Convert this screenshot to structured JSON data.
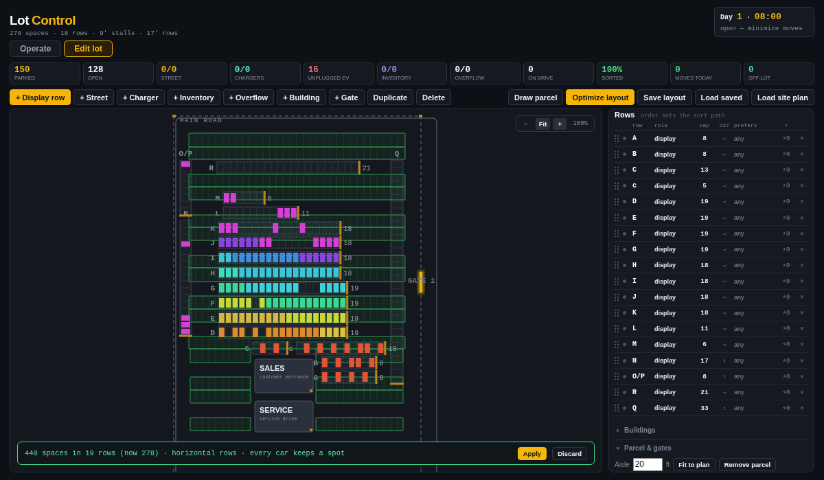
{
  "header": {
    "title_lead": "Lot",
    "title_accent": "Control",
    "subtitle": "278 spaces · 18 rows · 9' stalls · 17' rows",
    "modes": [
      {
        "label": "Operate",
        "selected": false
      },
      {
        "label": "Edit lot",
        "selected": true
      }
    ],
    "clock": {
      "day_label": "Day",
      "day": "1",
      "separator": "·",
      "time": "08:00",
      "status": "open — minimize moves"
    }
  },
  "stats": [
    {
      "value": "150",
      "label": "PARKED",
      "color": "#f5b50a"
    },
    {
      "value": "128",
      "label": "OPEN",
      "color": "#ffffff"
    },
    {
      "value": "0/0",
      "label": "STREET",
      "color": "#f5b50a"
    },
    {
      "value": "0/0",
      "label": "CHARGERS",
      "color": "#5eead4"
    },
    {
      "value": "16",
      "label": "UNPLUGGED EV",
      "color": "#f87171"
    },
    {
      "value": "0/0",
      "label": "INVENTORY",
      "color": "#a78bfa"
    },
    {
      "value": "0/0",
      "label": "OVERFLOW",
      "color": "#ffffff"
    },
    {
      "value": "0",
      "label": "ON DRIVE",
      "color": "#ffffff"
    },
    {
      "value": "100%",
      "label": "SORTED",
      "color": "#4ade80"
    },
    {
      "value": "0",
      "label": "MOVES TODAY",
      "color": "#4ade80"
    },
    {
      "value": "0",
      "label": "OFF-LOT",
      "color": "#4ade80"
    }
  ],
  "toolbar_left": [
    {
      "label": "+ Display row",
      "primary": true
    },
    {
      "label": "+ Street",
      "primary": false
    },
    {
      "label": "+ Charger",
      "primary": false
    },
    {
      "label": "+ Inventory",
      "primary": false
    },
    {
      "label": "+ Overflow",
      "primary": false
    },
    {
      "label": "+ Building",
      "primary": false
    },
    {
      "label": "+ Gate",
      "primary": false
    },
    {
      "label": "Duplicate",
      "primary": false
    },
    {
      "label": "Delete",
      "primary": false
    }
  ],
  "toolbar_right": [
    {
      "label": "Draw parcel",
      "primary": false
    },
    {
      "label": "Optimize layout",
      "primary": true
    },
    {
      "label": "Save layout",
      "primary": false
    },
    {
      "label": "Load saved",
      "primary": false
    },
    {
      "label": "Load site plan",
      "primary": false
    }
  ],
  "map": {
    "road_label": "MAIN ROAD",
    "gate_label": "GATE 1",
    "zoom": {
      "minus": "−",
      "fit": "Fit",
      "plus": "+",
      "percent": "100%"
    },
    "rows": [
      {
        "label": "O/P",
        "slots": [
          {
            "occupied": true,
            "color": "#d63fd6"
          },
          {
            "occupied": false
          },
          {
            "occupied": false
          },
          {
            "occupied": false
          },
          {
            "occupied": false
          },
          {
            "occupied": false
          },
          {
            "occupied": false
          },
          {
            "occupied": false
          }
        ]
      },
      {
        "label": "Q",
        "slots": [
          {
            "occupied": false
          },
          {
            "occupied": false
          },
          {
            "occupied": false
          },
          {
            "occupied": false
          },
          {
            "occupied": false
          },
          {
            "occupied": false
          },
          {
            "occupied": false
          },
          {
            "occupied": false
          },
          {
            "occupied": false
          },
          {
            "occupied": false
          },
          {
            "occupied": false
          },
          {
            "occupied": false
          },
          {
            "occupied": false
          },
          {
            "occupied": false
          },
          {
            "occupied": false
          },
          {
            "occupied": false
          },
          {
            "occupied": false
          },
          {
            "occupied": false
          },
          {
            "occupied": false
          },
          {
            "occupied": false
          },
          {
            "occupied": false
          },
          {
            "occupied": false
          },
          {
            "occupied": false
          },
          {
            "occupied": false
          },
          {
            "occupied": false
          },
          {
            "occupied": false
          },
          {
            "occupied": false
          },
          {
            "occupied": false
          },
          {
            "occupied": false
          },
          {
            "occupied": false
          },
          {
            "occupied": false
          },
          {
            "occupied": false
          },
          {
            "occupied": false
          }
        ]
      },
      {
        "label": "R",
        "count": "21",
        "slots": [
          {
            "occupied": false
          },
          {
            "occupied": false
          },
          {
            "occupied": false
          },
          {
            "occupied": false
          },
          {
            "occupied": false
          },
          {
            "occupied": false
          },
          {
            "occupied": false
          },
          {
            "occupied": false
          },
          {
            "occupied": false
          },
          {
            "occupied": false
          },
          {
            "occupied": false
          },
          {
            "occupied": false
          },
          {
            "occupied": false
          },
          {
            "occupied": false
          },
          {
            "occupied": false
          },
          {
            "occupied": false
          },
          {
            "occupied": false
          },
          {
            "occupied": false
          },
          {
            "occupied": false
          },
          {
            "occupied": false
          },
          {
            "occupied": false
          }
        ]
      },
      {
        "label": "M",
        "count": "6",
        "slots": [
          {
            "occupied": true,
            "color": "#d63fd6"
          },
          {
            "occupied": true,
            "color": "#d63fd6"
          },
          {
            "occupied": false
          },
          {
            "occupied": false
          },
          {
            "occupied": false
          },
          {
            "occupied": false
          }
        ]
      },
      {
        "label": "N",
        "slots": [
          {
            "occupied": false
          },
          {
            "occupied": false
          },
          {
            "occupied": false
          },
          {
            "occupied": true,
            "color": "#d63fd6"
          },
          {
            "occupied": false
          },
          {
            "occupied": false
          },
          {
            "occupied": false
          },
          {
            "occupied": false
          },
          {
            "occupied": false
          },
          {
            "occupied": false
          },
          {
            "occupied": false
          },
          {
            "occupied": false
          },
          {
            "occupied": false
          },
          {
            "occupied": false
          },
          {
            "occupied": true,
            "color": "#d63fd6"
          },
          {
            "occupied": true,
            "color": "#d63fd6"
          },
          {
            "occupied": true,
            "color": "#d63fd6"
          }
        ]
      },
      {
        "label": "L",
        "count": "11",
        "slots": [
          {
            "occupied": false
          },
          {
            "occupied": false
          },
          {
            "occupied": false
          },
          {
            "occupied": false
          },
          {
            "occupied": false
          },
          {
            "occupied": false
          },
          {
            "occupied": false
          },
          {
            "occupied": false
          },
          {
            "occupied": true,
            "color": "#d63fd6"
          },
          {
            "occupied": true,
            "color": "#d63fd6"
          },
          {
            "occupied": true,
            "color": "#d63fd6"
          }
        ]
      },
      {
        "label": "K",
        "count": "18",
        "slots": [
          {
            "occupied": true,
            "color": "#d63fd6"
          },
          {
            "occupied": true,
            "color": "#d63fd6"
          },
          {
            "occupied": true,
            "color": "#d63fd6"
          },
          {
            "occupied": false
          },
          {
            "occupied": false
          },
          {
            "occupied": false
          },
          {
            "occupied": false
          },
          {
            "occupied": false
          },
          {
            "occupied": true,
            "color": "#d63fd6"
          },
          {
            "occupied": false
          },
          {
            "occupied": false
          },
          {
            "occupied": false
          },
          {
            "occupied": true,
            "color": "#d63fd6"
          },
          {
            "occupied": false
          },
          {
            "occupied": false
          },
          {
            "occupied": false
          },
          {
            "occupied": false
          },
          {
            "occupied": false
          }
        ]
      },
      {
        "label": "J",
        "count": "18",
        "slots": [
          {
            "occupied": true,
            "color": "#8a45e0"
          },
          {
            "occupied": true,
            "color": "#8a45e0"
          },
          {
            "occupied": true,
            "color": "#8a45e0"
          },
          {
            "occupied": true,
            "color": "#8a45e0"
          },
          {
            "occupied": true,
            "color": "#8a45e0"
          },
          {
            "occupied": true,
            "color": "#8a45e0"
          },
          {
            "occupied": true,
            "color": "#d63fd6"
          },
          {
            "occupied": true,
            "color": "#d63fd6"
          },
          {
            "occupied": false
          },
          {
            "occupied": false
          },
          {
            "occupied": false
          },
          {
            "occupied": false
          },
          {
            "occupied": false
          },
          {
            "occupied": false
          },
          {
            "occupied": true,
            "color": "#d63fd6"
          },
          {
            "occupied": true,
            "color": "#d63fd6"
          },
          {
            "occupied": true,
            "color": "#d63fd6"
          },
          {
            "occupied": true,
            "color": "#d63fd6"
          }
        ]
      },
      {
        "label": "I",
        "count": "18",
        "slots": [
          {
            "occupied": true,
            "color": "#3cc4d8"
          },
          {
            "occupied": true,
            "color": "#3cc4d8"
          },
          {
            "occupied": true,
            "color": "#3d8ee0"
          },
          {
            "occupied": true,
            "color": "#3d8ee0"
          },
          {
            "occupied": true,
            "color": "#3d8ee0"
          },
          {
            "occupied": true,
            "color": "#3d8ee0"
          },
          {
            "occupied": true,
            "color": "#3d8ee0"
          },
          {
            "occupied": true,
            "color": "#3d8ee0"
          },
          {
            "occupied": true,
            "color": "#3d8ee0"
          },
          {
            "occupied": true,
            "color": "#3d8ee0"
          },
          {
            "occupied": true,
            "color": "#3d8ee0"
          },
          {
            "occupied": true,
            "color": "#3d8ee0"
          },
          {
            "occupied": true,
            "color": "#8a45e0"
          },
          {
            "occupied": true,
            "color": "#8a45e0"
          },
          {
            "occupied": true,
            "color": "#8a45e0"
          },
          {
            "occupied": true,
            "color": "#8a45e0"
          },
          {
            "occupied": true,
            "color": "#8a45e0"
          },
          {
            "occupied": true,
            "color": "#8a45e0"
          }
        ]
      },
      {
        "label": "H",
        "count": "18",
        "slots": [
          {
            "occupied": true,
            "color": "#3ddcc0"
          },
          {
            "occupied": true,
            "color": "#3ddcc0"
          },
          {
            "occupied": true,
            "color": "#3ddcc0"
          },
          {
            "occupied": true,
            "color": "#3cc4d8"
          },
          {
            "occupied": true,
            "color": "#3cc4d8"
          },
          {
            "occupied": true,
            "color": "#3cc4d8"
          },
          {
            "occupied": true,
            "color": "#3cc4d8"
          },
          {
            "occupied": true,
            "color": "#3cc4d8"
          },
          {
            "occupied": true,
            "color": "#3cc4d8"
          },
          {
            "occupied": true,
            "color": "#3cc4d8"
          },
          {
            "occupied": true,
            "color": "#3cc4d8"
          },
          {
            "occupied": true,
            "color": "#3cc4d8"
          },
          {
            "occupied": true,
            "color": "#3cc4d8"
          },
          {
            "occupied": true,
            "color": "#3cc4d8"
          },
          {
            "occupied": true,
            "color": "#3cc4d8"
          },
          {
            "occupied": true,
            "color": "#3cc4d8"
          },
          {
            "occupied": true,
            "color": "#3cc4d8"
          },
          {
            "occupied": true,
            "color": "#3cc4d8"
          }
        ]
      },
      {
        "label": "G",
        "count": "19",
        "slots": [
          {
            "occupied": true,
            "color": "#3dd6a0"
          },
          {
            "occupied": true,
            "color": "#3dd6a0"
          },
          {
            "occupied": true,
            "color": "#3dd6a0"
          },
          {
            "occupied": true,
            "color": "#3dd6a0"
          },
          {
            "occupied": true,
            "color": "#3cd0d8"
          },
          {
            "occupied": true,
            "color": "#3cd0d8"
          },
          {
            "occupied": true,
            "color": "#3cd0d8"
          },
          {
            "occupied": true,
            "color": "#3cd0d8"
          },
          {
            "occupied": true,
            "color": "#3cd0d8"
          },
          {
            "occupied": true,
            "color": "#3cd0d8"
          },
          {
            "occupied": true,
            "color": "#3cd0d8"
          },
          {
            "occupied": true,
            "color": "#3cd0d8"
          },
          {
            "occupied": false
          },
          {
            "occupied": false
          },
          {
            "occupied": false
          },
          {
            "occupied": true,
            "color": "#3cd0d8"
          },
          {
            "occupied": true,
            "color": "#3cd0d8"
          },
          {
            "occupied": true,
            "color": "#3cd0d8"
          },
          {
            "occupied": true,
            "color": "#3cd0d8"
          }
        ]
      },
      {
        "label": "F",
        "count": "19",
        "slots": [
          {
            "occupied": true,
            "color": "#c6d83a"
          },
          {
            "occupied": true,
            "color": "#c6d83a"
          },
          {
            "occupied": true,
            "color": "#c6d83a"
          },
          {
            "occupied": true,
            "color": "#c6d83a"
          },
          {
            "occupied": true,
            "color": "#c6d83a"
          },
          {
            "occupied": false
          },
          {
            "occupied": true,
            "color": "#c6d83a"
          },
          {
            "occupied": true,
            "color": "#3ad890"
          },
          {
            "occupied": true,
            "color": "#3ad890"
          },
          {
            "occupied": true,
            "color": "#3ad890"
          },
          {
            "occupied": true,
            "color": "#3ad890"
          },
          {
            "occupied": true,
            "color": "#3ad890"
          },
          {
            "occupied": true,
            "color": "#3ad890"
          },
          {
            "occupied": true,
            "color": "#3ad890"
          },
          {
            "occupied": true,
            "color": "#3ad890"
          },
          {
            "occupied": true,
            "color": "#3ad890"
          },
          {
            "occupied": true,
            "color": "#3ad890"
          },
          {
            "occupied": true,
            "color": "#3ad890"
          },
          {
            "occupied": true,
            "color": "#3ad890"
          }
        ]
      },
      {
        "label": "E",
        "count": "19",
        "slots": [
          {
            "occupied": true,
            "color": "#d4b844"
          },
          {
            "occupied": true,
            "color": "#d4b844"
          },
          {
            "occupied": true,
            "color": "#d4b844"
          },
          {
            "occupied": true,
            "color": "#d4b844"
          },
          {
            "occupied": true,
            "color": "#d4b844"
          },
          {
            "occupied": true,
            "color": "#d4b844"
          },
          {
            "occupied": true,
            "color": "#d4b844"
          },
          {
            "occupied": true,
            "color": "#d4b844"
          },
          {
            "occupied": true,
            "color": "#d4b844"
          },
          {
            "occupied": true,
            "color": "#d4b844"
          },
          {
            "occupied": true,
            "color": "#c6d83a"
          },
          {
            "occupied": true,
            "color": "#c6d83a"
          },
          {
            "occupied": true,
            "color": "#c6d83a"
          },
          {
            "occupied": true,
            "color": "#c6d83a"
          },
          {
            "occupied": true,
            "color": "#c6d83a"
          },
          {
            "occupied": true,
            "color": "#c6d83a"
          },
          {
            "occupied": true,
            "color": "#c6d83a"
          },
          {
            "occupied": true,
            "color": "#c6d83a"
          },
          {
            "occupied": true,
            "color": "#c6d83a"
          }
        ]
      },
      {
        "label": "D",
        "count": "19",
        "slots": [
          {
            "occupied": true,
            "color": "#e08a2e"
          },
          {
            "occupied": false
          },
          {
            "occupied": true,
            "color": "#e08a2e"
          },
          {
            "occupied": true,
            "color": "#e08a2e"
          },
          {
            "occupied": false
          },
          {
            "occupied": true,
            "color": "#e08a2e"
          },
          {
            "occupied": false
          },
          {
            "occupied": true,
            "color": "#e08a2e"
          },
          {
            "occupied": true,
            "color": "#e08a2e"
          },
          {
            "occupied": true,
            "color": "#e08a2e"
          },
          {
            "occupied": true,
            "color": "#e08a2e"
          },
          {
            "occupied": true,
            "color": "#e08a2e"
          },
          {
            "occupied": true,
            "color": "#e08a2e"
          },
          {
            "occupied": true,
            "color": "#e08a2e"
          },
          {
            "occupied": true,
            "color": "#e08a2e"
          },
          {
            "occupied": true,
            "color": "#e0c040"
          },
          {
            "occupied": true,
            "color": "#e0c040"
          },
          {
            "occupied": true,
            "color": "#e0c040"
          },
          {
            "occupied": true,
            "color": "#e0c040"
          }
        ]
      },
      {
        "label": "C",
        "slots": [
          {
            "occupied": false
          },
          {
            "occupied": true,
            "color": "#e2553a"
          },
          {
            "occupied": false
          },
          {
            "occupied": true,
            "color": "#e2553a"
          },
          {
            "occupied": false
          }
        ]
      },
      {
        "label": "c",
        "count": "13",
        "slots": [
          {
            "occupied": false
          },
          {
            "occupied": true,
            "color": "#e2553a"
          },
          {
            "occupied": false
          },
          {
            "occupied": true,
            "color": "#e2553a"
          },
          {
            "occupied": false
          },
          {
            "occupied": true,
            "color": "#e2553a"
          },
          {
            "occupied": false
          },
          {
            "occupied": true,
            "color": "#e2553a"
          },
          {
            "occupied": false
          },
          {
            "occupied": true,
            "color": "#e2553a"
          },
          {
            "occupied": true,
            "color": "#e2553a"
          },
          {
            "occupied": false
          },
          {
            "occupied": true,
            "color": "#e2553a"
          }
        ]
      },
      {
        "label": "B",
        "count": "8",
        "slots": [
          {
            "occupied": true,
            "color": "#e2553a"
          },
          {
            "occupied": false
          },
          {
            "occupied": true,
            "color": "#e2553a"
          },
          {
            "occupied": false
          },
          {
            "occupied": true,
            "color": "#e2553a"
          },
          {
            "occupied": true,
            "color": "#e2553a"
          },
          {
            "occupied": false
          },
          {
            "occupied": true,
            "color": "#e2553a"
          }
        ]
      },
      {
        "label": "A",
        "count": "8",
        "slots": [
          {
            "occupied": true,
            "color": "#e2553a"
          },
          {
            "occupied": false
          },
          {
            "occupied": true,
            "color": "#e2553a"
          },
          {
            "occupied": false
          },
          {
            "occupied": true,
            "color": "#e2553a"
          },
          {
            "occupied": false
          },
          {
            "occupied": true,
            "color": "#e2553a"
          },
          {
            "occupied": false
          }
        ]
      }
    ],
    "buildings": [
      {
        "name": "SALES",
        "note": "customer entrance"
      },
      {
        "name": "SERVICE",
        "note": "service drive"
      }
    ],
    "proposal": {
      "message": "440 spaces in 19 rows (now 278) · horizontal rows · every car keeps a spot",
      "apply": "Apply",
      "discard": "Discard"
    }
  },
  "rows_panel": {
    "title": "Rows",
    "hint": "order sets the sort path",
    "columns": [
      "row",
      "role",
      "cap",
      "dir",
      "prefers",
      "⚡"
    ],
    "rows": [
      {
        "row": "A",
        "role": "display",
        "cap": "8",
        "dir": "⇔",
        "prefers": "any",
        "charge": "⚡0",
        "remove": "×"
      },
      {
        "row": "B",
        "role": "display",
        "cap": "8",
        "dir": "⇔",
        "prefers": "any",
        "charge": "⚡0",
        "remove": "×"
      },
      {
        "row": "C",
        "role": "display",
        "cap": "13",
        "dir": "⇔",
        "prefers": "any",
        "charge": "⚡0",
        "remove": "×"
      },
      {
        "row": "c",
        "role": "display",
        "cap": "5",
        "dir": "⇔",
        "prefers": "any",
        "charge": "⚡0",
        "remove": "×"
      },
      {
        "row": "D",
        "role": "display",
        "cap": "19",
        "dir": "⇔",
        "prefers": "any",
        "charge": "⚡0",
        "remove": "×"
      },
      {
        "row": "E",
        "role": "display",
        "cap": "19",
        "dir": "⇔",
        "prefers": "any",
        "charge": "⚡0",
        "remove": "×"
      },
      {
        "row": "F",
        "role": "display",
        "cap": "19",
        "dir": "⇔",
        "prefers": "any",
        "charge": "⚡0",
        "remove": "×"
      },
      {
        "row": "G",
        "role": "display",
        "cap": "19",
        "dir": "⇔",
        "prefers": "any",
        "charge": "⚡0",
        "remove": "×"
      },
      {
        "row": "H",
        "role": "display",
        "cap": "18",
        "dir": "⇔",
        "prefers": "any",
        "charge": "⚡0",
        "remove": "×"
      },
      {
        "row": "I",
        "role": "display",
        "cap": "18",
        "dir": "⇔",
        "prefers": "any",
        "charge": "⚡0",
        "remove": "×"
      },
      {
        "row": "J",
        "role": "display",
        "cap": "18",
        "dir": "⇔",
        "prefers": "any",
        "charge": "⚡0",
        "remove": "×"
      },
      {
        "row": "K",
        "role": "display",
        "cap": "18",
        "dir": "⇔",
        "prefers": "any",
        "charge": "⚡0",
        "remove": "×"
      },
      {
        "row": "L",
        "role": "display",
        "cap": "11",
        "dir": "⇔",
        "prefers": "any",
        "charge": "⚡0",
        "remove": "×"
      },
      {
        "row": "M",
        "role": "display",
        "cap": "6",
        "dir": "⇔",
        "prefers": "any",
        "charge": "⚡0",
        "remove": "×"
      },
      {
        "row": "N",
        "role": "display",
        "cap": "17",
        "dir": "↕",
        "prefers": "any",
        "charge": "⚡0",
        "remove": "×"
      },
      {
        "row": "O/P",
        "role": "display",
        "cap": "8",
        "dir": "↕",
        "prefers": "any",
        "charge": "⚡0",
        "remove": "×"
      },
      {
        "row": "R",
        "role": "display",
        "cap": "21",
        "dir": "⇔",
        "prefers": "any",
        "charge": "⚡0",
        "remove": "×"
      },
      {
        "row": "Q",
        "role": "display",
        "cap": "33",
        "dir": "↕",
        "prefers": "any",
        "charge": "⚡0",
        "remove": "×"
      }
    ],
    "sections": [
      {
        "label": "Buildings",
        "expanded": false
      },
      {
        "label": "Parcel & gates",
        "expanded": true
      }
    ],
    "aisle": {
      "label": "Aisle",
      "value": "20",
      "unit": "ft",
      "buttons": [
        "Fit to plan",
        "Remove parcel"
      ]
    }
  }
}
